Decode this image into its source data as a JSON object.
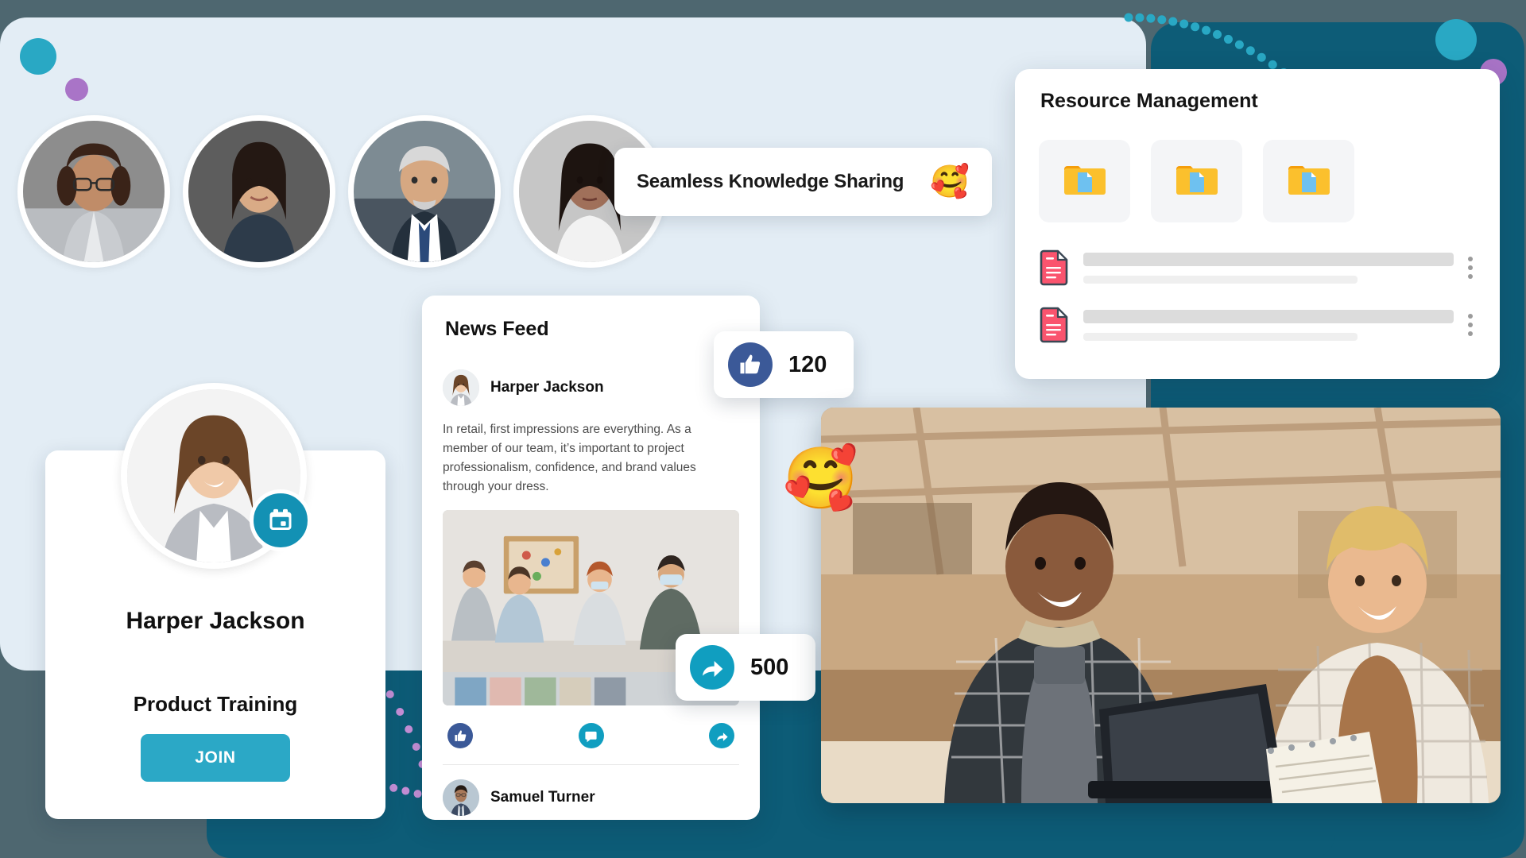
{
  "theme": {
    "accent_teal": "#2BA8C6",
    "accent_dark_teal": "#0D5C77",
    "accent_purple": "#A974C7",
    "panel_bg": "#E3EDF5",
    "page_bg": "#4E6770",
    "facebook_blue": "#3B5998"
  },
  "banner": {
    "text": "Seamless Knowledge Sharing",
    "emoji": "🥰",
    "emoji_name": "smiling-face-with-hearts-emoji"
  },
  "resource_panel": {
    "title": "Resource Management",
    "folders": [
      {
        "name": "folder-tile-1",
        "icon": "folder-document-icon"
      },
      {
        "name": "folder-tile-2",
        "icon": "folder-document-icon"
      },
      {
        "name": "folder-tile-3",
        "icon": "folder-document-icon"
      }
    ],
    "files": [
      {
        "icon": "document-red-icon",
        "menu": "kebab-menu-icon"
      },
      {
        "icon": "document-red-icon",
        "menu": "kebab-menu-icon"
      }
    ]
  },
  "avatars": [
    {
      "name": "avatar-person-1"
    },
    {
      "name": "avatar-person-2"
    },
    {
      "name": "avatar-person-3"
    },
    {
      "name": "avatar-person-4"
    }
  ],
  "profile_card": {
    "name": "Harper Jackson",
    "course": "Product Training",
    "join_label": "JOIN",
    "badge_icon": "calendar-icon"
  },
  "news_feed": {
    "title": "News Feed",
    "author": "Harper Jackson",
    "post_text": "In retail, first impressions are everything. As a member of our team, it’s important to project professionalism, confidence, and brand values through your dress.",
    "actions": [
      {
        "name": "like-action",
        "icon": "thumbs-up-icon"
      },
      {
        "name": "comment-action",
        "icon": "comment-icon"
      },
      {
        "name": "share-action",
        "icon": "share-arrow-icon"
      }
    ],
    "footer_user": "Samuel Turner"
  },
  "badges": {
    "like": {
      "count": "120",
      "icon": "thumbs-up-icon"
    },
    "share": {
      "count": "500",
      "icon": "share-arrow-icon"
    }
  },
  "hero": {
    "emoji": "🥰",
    "emoji_name": "smiling-face-with-hearts-emoji",
    "photo_name": "workshop-team-photo"
  }
}
